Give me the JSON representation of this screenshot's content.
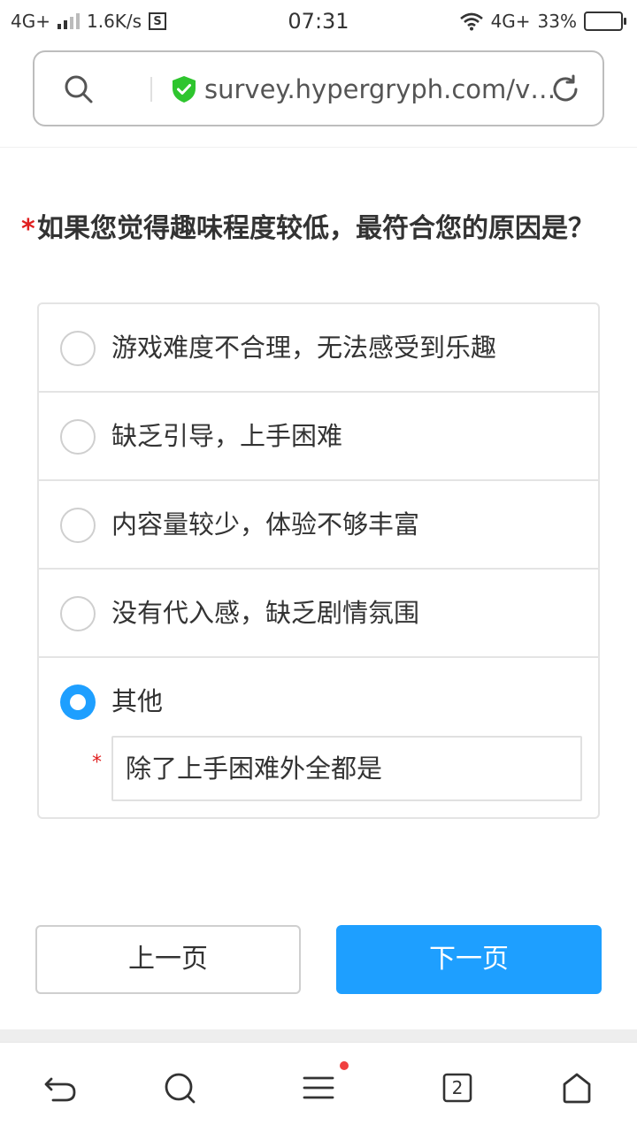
{
  "status_bar": {
    "network_left": "4G+",
    "speed": "1.6K/s",
    "s_badge": "S",
    "time": "07:31",
    "network_right": "4G+",
    "battery": "33%",
    "battery_level": 0.33
  },
  "address_bar": {
    "url": "survey.hypergryph.com/v…",
    "icons": [
      "search-icon",
      "shield-check-icon",
      "refresh-icon"
    ],
    "shield_color": "#2ec52e"
  },
  "question": {
    "required_mark": "*",
    "text": "如果您觉得趣味程度较低，最符合您的原因是？"
  },
  "options": [
    {
      "label": "游戏难度不合理，无法感受到乐趣",
      "selected": false
    },
    {
      "label": "缺乏引导，上手困难",
      "selected": false
    },
    {
      "label": "内容量较少，体验不够丰富",
      "selected": false
    },
    {
      "label": "没有代入感，缺乏剧情氛围",
      "selected": false
    },
    {
      "label": "其他",
      "selected": true
    }
  ],
  "other_input": {
    "required_mark": "*",
    "value": "除了上手困难外全都是"
  },
  "nav": {
    "prev_label": "上一页",
    "next_label": "下一页"
  },
  "toolbar": {
    "tabs_count": "2",
    "icons": [
      "back-icon",
      "search-icon",
      "menu-icon",
      "tabs-icon",
      "home-icon"
    ]
  },
  "colors": {
    "accent": "#1e9fff",
    "required": "#e02020",
    "notification_dot": "#f04040"
  }
}
